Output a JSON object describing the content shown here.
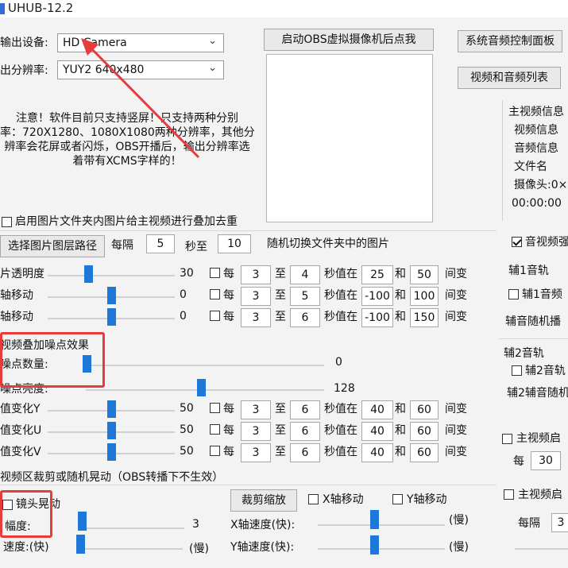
{
  "window": {
    "title": "UHUB-12.2"
  },
  "device": {
    "label": "输出设备:",
    "value": "HD Camera"
  },
  "resolution": {
    "label": "出分辨率:",
    "value": "YUY2 640x480"
  },
  "notice": [
    "注意！软件目前只支持竖屏！只支持两种分别",
    "率：720X1280、1080X1080两种分辨率，其他分",
    "辨率会花屏或者闪烁，OBS开播后，输出分辨率选",
    "着带有XCMS字样的！"
  ],
  "buttons": {
    "start_obs": "启动OBS虚拟摄像机后点我",
    "sys_audio": "系统音频控制面板",
    "av_list": "视频和音频列表",
    "select_path": "选择图片图层路径",
    "crop_zoom": "裁剪缩放"
  },
  "info": {
    "title": "主视频信息",
    "lines": [
      "视频信息",
      "音频信息",
      "文件名",
      "摄像头:0×",
      "00:00:00"
    ]
  },
  "overlay": {
    "enable_label": "启用图片文件夹内图片给主视频进行叠加去重",
    "every_label": "每隔",
    "every_value": "5",
    "sec_to": "秒至",
    "sec_value": "10",
    "random_label": "随机切换文件夹中的图片"
  },
  "labels": {
    "each": "每",
    "to": "至",
    "sec_val": "秒值在",
    "and": "和",
    "change": "间变"
  },
  "rows": [
    {
      "label": "片透明度",
      "value": "30",
      "pos": 0.32,
      "a": "3",
      "b": "4",
      "c": "25",
      "d": "50"
    },
    {
      "label": "轴移动",
      "value": "0",
      "pos": 0.5,
      "a": "3",
      "b": "5",
      "c": "-100",
      "d": "100"
    },
    {
      "label": "轴移动",
      "value": "0",
      "pos": 0.5,
      "a": "3",
      "b": "6",
      "c": "-100",
      "d": "150"
    }
  ],
  "noise": {
    "title": "视频叠加噪点效果",
    "count_label": "噪点数量:",
    "count_value": "0",
    "count_pos": 0.0,
    "bright_label": "噪点亮度:",
    "bright_value": "128",
    "bright_pos": 0.5
  },
  "yuv": [
    {
      "label": "值变化Y",
      "value": "50",
      "pos": 0.5,
      "a": "3",
      "b": "6",
      "c": "40",
      "d": "60"
    },
    {
      "label": "值变化U",
      "value": "50",
      "pos": 0.5,
      "a": "3",
      "b": "6",
      "c": "40",
      "d": "60"
    },
    {
      "label": "值变化V",
      "value": "50",
      "pos": 0.5,
      "a": "3",
      "b": "6",
      "c": "40",
      "d": "60"
    }
  ],
  "crop": {
    "section_title": "视频区裁剪或随机晃动（OBS转播下不生效）",
    "shake_label": "镜头晃动",
    "amp_label": "幅度:",
    "amp_value": "3",
    "speed_label": "速度:(快)",
    "speed_slow": "(慢)",
    "x_move": "X轴移动",
    "y_move": "Y轴移动",
    "x_speed": "X轴速度(快):",
    "y_speed": "Y轴速度(快):",
    "slow": "(慢)"
  },
  "audio": {
    "enable": "音视频强",
    "aux1": "辅1音轨",
    "aux1_cb": "辅1音频",
    "aux_random": "辅音随机播",
    "aux2": "辅2音轨",
    "aux2_cb": "辅2音轨",
    "aux2_random": "辅2辅音随机",
    "main_start": "主视频启",
    "each": "每",
    "each_value": "30",
    "main_start2": "主视频启",
    "every": "每隔",
    "every_value": "3"
  },
  "colors": {
    "accent": "#1d78d7",
    "highlight": "#e83b3b"
  }
}
